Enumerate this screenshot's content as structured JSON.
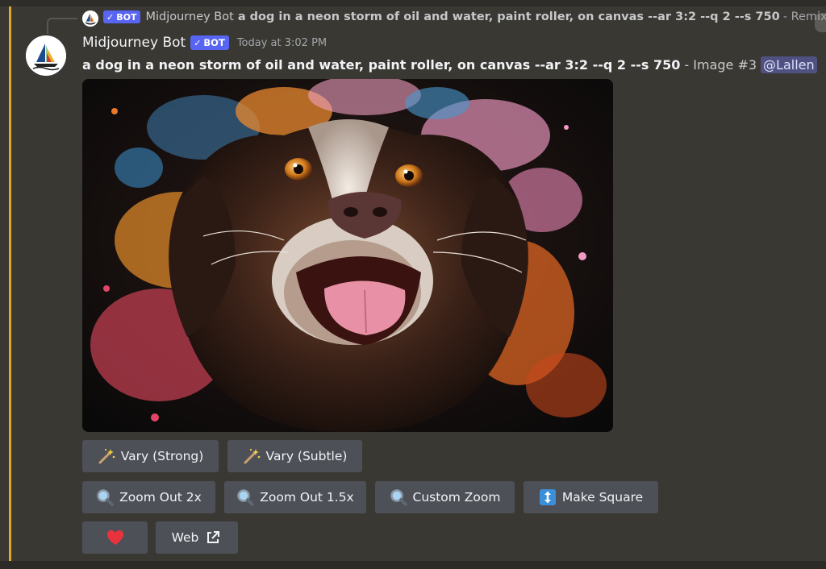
{
  "reply": {
    "badge": "BOT",
    "author": "Midjourney Bot",
    "prompt": "a dog in a neon storm of oil and water, paint roller, on canvas --ar 3:2 --q 2 --s 750",
    "suffix": "- Remix by"
  },
  "message": {
    "author": "Midjourney Bot",
    "badge": "BOT",
    "timestamp": "Today at 3:02 PM",
    "prompt": "a dog in a neon storm of oil and water, paint roller, on canvas --ar 3:2 --q 2 --s 750",
    "separator": "- Image #3",
    "mention": "@Lallen"
  },
  "image": {
    "subject": "neon-splatter-dog-painting"
  },
  "buttons": {
    "vary_strong": "Vary (Strong)",
    "vary_subtle": "Vary (Subtle)",
    "zoom_out_2x": "Zoom Out 2x",
    "zoom_out_1_5x": "Zoom Out 1.5x",
    "custom_zoom": "Custom Zoom",
    "make_square": "Make Square",
    "web": "Web"
  },
  "icons": {
    "magic_wand": "magic-wand-icon",
    "magnifier": "magnifier-icon",
    "up_down_arrow": "up-down-arrow-icon",
    "heart": "heart-icon",
    "external_link": "external-link-icon"
  },
  "colors": {
    "background": "#3a3833",
    "highlight_bar": "#e0a92a",
    "bot_badge": "#5865f2",
    "button": "#4e5058",
    "heart": "#e8333f",
    "mention_bg": "#4f5182"
  }
}
